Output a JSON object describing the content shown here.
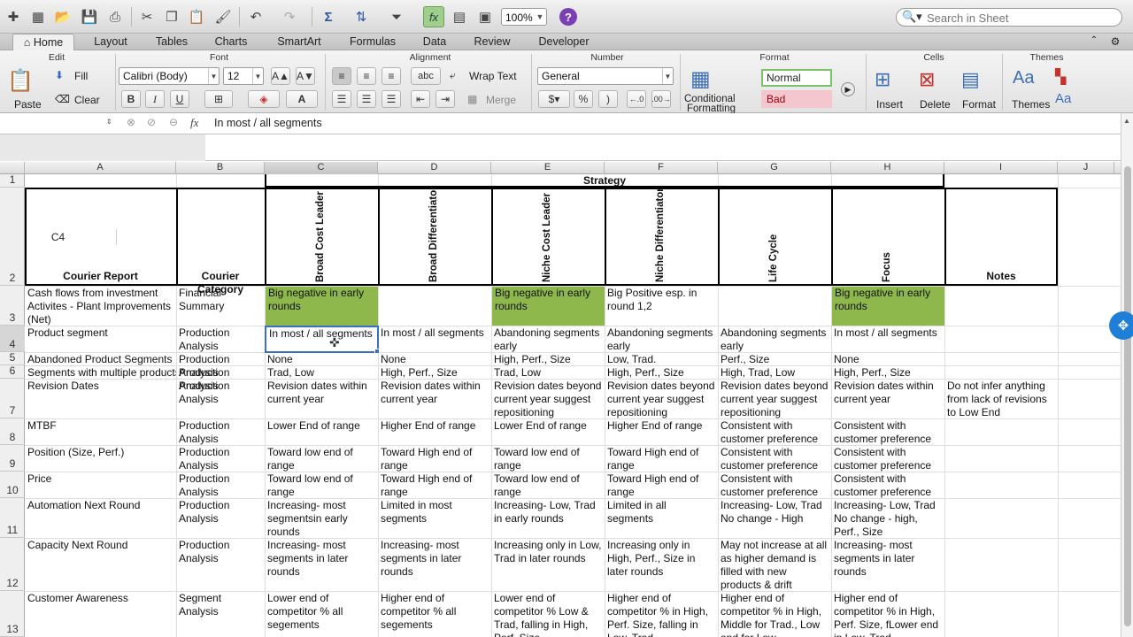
{
  "toolbar": {
    "zoom": "100%",
    "search_placeholder": "Search in Sheet",
    "icons": [
      "new-icon",
      "templates-icon",
      "open-icon",
      "save-icon",
      "print-icon",
      "cut-icon",
      "copy-icon",
      "paste-icon",
      "format-painter-icon",
      "undo-icon",
      "redo-icon",
      "autosum-icon",
      "sort-icon",
      "filter-icon",
      "function-icon",
      "show-hide-icon",
      "media-icon",
      "help-icon"
    ]
  },
  "tabs": [
    "Home",
    "Layout",
    "Tables",
    "Charts",
    "SmartArt",
    "Formulas",
    "Data",
    "Review",
    "Developer"
  ],
  "ribbon": {
    "groups": {
      "edit": "Edit",
      "font": "Font",
      "alignment": "Alignment",
      "number": "Number",
      "format": "Format",
      "cells": "Cells",
      "themes": "Themes"
    },
    "paste": "Paste",
    "fill": "Fill",
    "clear": "Clear",
    "font_name": "Calibri (Body)",
    "font_size": "12",
    "bold": "B",
    "italic": "I",
    "underline": "U",
    "wrap_text": "Wrap Text",
    "merge": "Merge",
    "abc": "abc",
    "number_format": "General",
    "percent": "%",
    "comma": ")",
    "cond_fmt_1": "Conditional",
    "cond_fmt_2": "Formatting",
    "style_normal": "Normal",
    "style_bad": "Bad",
    "insert": "Insert",
    "delete": "Delete",
    "format": "Format",
    "themes": "Themes"
  },
  "formula_bar": {
    "name_box": "C4",
    "fx": "fx",
    "content": "In most / all segments"
  },
  "columns": [
    "A",
    "B",
    "C",
    "D",
    "E",
    "F",
    "G",
    "H",
    "I",
    "J"
  ],
  "rows": [
    "1",
    "2",
    "3",
    "4",
    "5",
    "6",
    "7",
    "8",
    "9",
    "10",
    "11",
    "12",
    "13"
  ],
  "sheet": {
    "strategy_header": "Strategy",
    "headers": {
      "A": "Courier Report",
      "B": "Courier Category",
      "C": "Broad Cost Leader",
      "D": "Broad Differentiator",
      "E": "Niche Cost Leader",
      "F": "Niche Differentiator",
      "G": "Life Cycle",
      "H": "Focus",
      "I": "Notes"
    },
    "r3": {
      "A": "Cash flows from investment Activites - Plant Improvements (Net)",
      "B": "Financial Summary",
      "C": "Big negative in early rounds",
      "D": "",
      "E": "Big negative in early rounds",
      "F": "Big Positive esp. in round 1,2",
      "G": "",
      "H": "Big negative in early rounds"
    },
    "r4": {
      "A": "Product segment",
      "B": "Production Analysis",
      "C": "In most / all segments",
      "D": "In most / all segments",
      "E": "Abandoning segments early",
      "F": "Abandoning segments early",
      "G": "Abandoning segments early",
      "H": "In most / all segments"
    },
    "r5": {
      "A": "Abandoned Product Segments",
      "B": "Production Analysis",
      "C": "None",
      "D": "None",
      "E": "High, Perf., Size",
      "F": "Low, Trad.",
      "G": "Perf., Size",
      "H": "None"
    },
    "r6": {
      "A": "Segments with multiple products",
      "B": "Production Analysis",
      "C": "Trad, Low",
      "D": "High, Perf., Size",
      "E": "Trad, Low",
      "F": "High, Perf., Size",
      "G": "High, Trad, Low",
      "H": "High, Perf., Size"
    },
    "r7": {
      "A": "Revision Dates",
      "B": "Production Analysis",
      "C": "Revision dates within current year",
      "D": "Revision dates within current year",
      "E": "Revision dates beyond current year suggest repositioning",
      "F": "Revision dates beyond current year suggest repositioning",
      "G": "Revision dates beyond current year suggest repositioning",
      "H": "Revision dates within current year",
      "I": "Do not infer anything from lack of revisions to Low End"
    },
    "r8": {
      "A": "MTBF",
      "B": "Production Analysis",
      "C": "Lower End of range",
      "D": "Higher End of range",
      "E": "Lower End of range",
      "F": "Higher End of range",
      "G": "Consistent with customer preference",
      "H": "Consistent with customer preference"
    },
    "r9": {
      "A": "Position (Size, Perf.)",
      "B": "Production Analysis",
      "C": "Toward low end of range",
      "D": "Toward High end of range",
      "E": "Toward low end of range",
      "F": "Toward High end of range",
      "G": "Consistent with customer preference",
      "H": "Consistent with customer preference"
    },
    "r10": {
      "A": "Price",
      "B": "Production Analysis",
      "C": "Toward low end of range",
      "D": "Toward High end of range",
      "E": "Toward low end of range",
      "F": "Toward High end of range",
      "G": "Consistent with customer preference",
      "H": "Consistent with customer preference"
    },
    "r11": {
      "A": "Automation Next Round",
      "B": "Production Analysis",
      "C": "Increasing- most segmentsin early rounds",
      "D": "Limited in most segments",
      "E": "Increasing- Low, Trad in early rounds",
      "F": "Limited in all segments",
      "G": "Increasing- Low, Trad No change - High",
      "H": "Increasing- Low, Trad No change - high, Perf., Size"
    },
    "r12": {
      "A": "Capacity Next Round",
      "B": "Production Analysis",
      "C": "Increasing- most segments in later rounds",
      "D": "Increasing- most segments in later rounds",
      "E": "Increasing only in Low, Trad in later rounds",
      "F": "Increasing only in High, Perf., Size in later rounds",
      "G": "May not increase at all as higher demand is filled with new products & drift",
      "H": "Increasing- most segments in later rounds"
    },
    "r13": {
      "A": "Customer Awareness",
      "B": "Segment Analysis",
      "C": "Lower end of competitor % all segements",
      "D": "Higher end of competitor % all segements",
      "E": "Lower end of competitor % Low & Trad, falling in High, Perf. Size",
      "F": "Higher end of competitor % in High, Perf. Size, falling in Low, Trad",
      "G": "Higher end of competitor % in High, Middle for Trad., Low end for Low",
      "H": "Higher end of competitor % in High, Perf. Size, fLower end in Low, Trad"
    }
  },
  "colors": {
    "green_fill": "#8fb84c",
    "bad_fill": "#f4c7ce",
    "selection": "#3b6ec9"
  }
}
